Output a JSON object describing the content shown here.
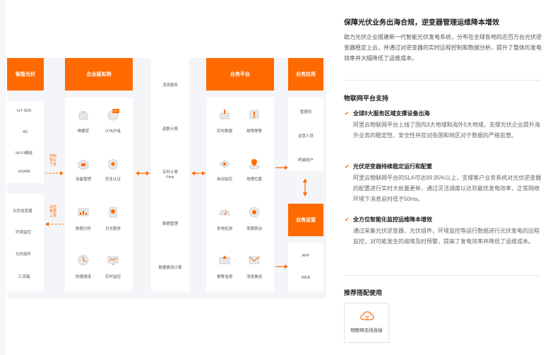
{
  "diagram": {
    "smart_pv": {
      "header": "智能光伏",
      "protocols": [
        "IoT SDK",
        "4G",
        "Wi-Fi模组",
        "RS485"
      ],
      "devices": [
        "光伏逆变器",
        "环境监控",
        "光伏组件",
        "汇流箱"
      ],
      "control_label": "控制指令下发",
      "status_label": "状态数据上报"
    },
    "enterprise": {
      "header": "企业版实例",
      "items": [
        "物模型",
        "OTA升级",
        "设备管理",
        "安全认证",
        "数据分析",
        "日志服务",
        "防帽滚措",
        "实时监控"
      ],
      "ota_badge": "OTA"
    },
    "services": [
      "消息服务",
      "函数计算",
      "实时计算 Flink",
      "数据管理",
      "数据离线计算"
    ],
    "platform": {
      "header": "业务平台",
      "items": [
        "实时数据",
        "故障预警",
        "自动监控",
        "地理位置",
        "发电检测",
        "场景联动",
        "报警追溯",
        "消息推送"
      ]
    },
    "apps": {
      "header": "业务应用",
      "items": [
        "管理员",
        "运营人员",
        "终端用户"
      ]
    },
    "ops": {
      "header": "业务运营",
      "items": [
        "APP",
        "WEB"
      ]
    }
  },
  "panel": {
    "title": "保障光伏业务出海合规，逆变器管理运维降本增效",
    "intro": "助力光伏企业搭建新一代智能光伏发电系统，分布在全球各地的近百万台光伏逆变器稳定上云，并通过对逆变器的实时远程控制和数据分析，提升了整体的发电效率并大幅降低了运维成本。",
    "support_title": "物联网平台支持",
    "features": [
      {
        "title": "全球8大服务区域支撑设备出海",
        "desc": "阿里云物联网平台上线了国内3大地域和海外5大地域，支撑光伏企业提升海外业务的稳定性、安全性并应对各国和地区对于数据的严格监管。"
      },
      {
        "title": "光伏逆变器持续稳定运行和配置",
        "desc": "阿里云物联网平台的SLA可达99.95%以上，支撑客户业务系统对光伏逆变器的配置进行实时大批量更新，通过灵活调度以达到最优发电效率，正常网络环境下消息延时低于50ms。"
      },
      {
        "title": "全方位智能化监控运维降本增效",
        "desc": "通过采集光伏逆变器、光伏组件、环境监控等运行数据进行光伏发电的远程监控，对可能发生的故障及时预警，提高了发电效率并降低了运维成本。"
      }
    ],
    "recommend_title": "推荐搭配使用",
    "recommend_card": "物联网无线连接",
    "colors": {
      "accent": "#ff6a00"
    }
  }
}
